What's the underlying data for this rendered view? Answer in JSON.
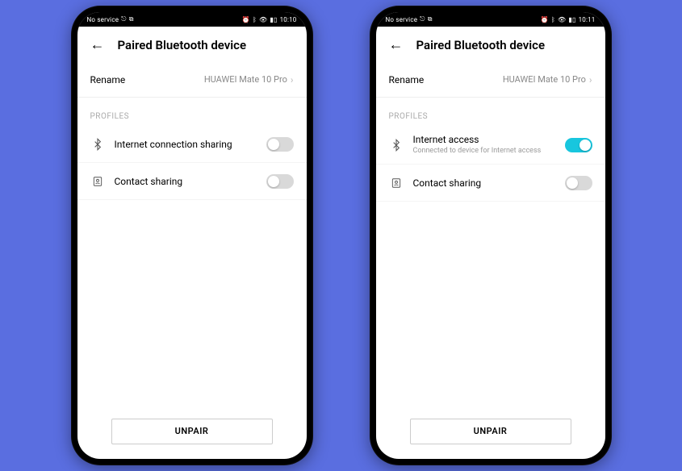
{
  "phones": [
    {
      "status": {
        "left": "No service",
        "right": {
          "time": "10:10"
        }
      },
      "header": {
        "title": "Paired Bluetooth device"
      },
      "rename": {
        "label": "Rename",
        "value": "HUAWEI Mate 10 Pro"
      },
      "section": "PROFILES",
      "profiles": [
        {
          "icon": "bluetooth-share-icon",
          "title": "Internet connection sharing",
          "subtitle": "",
          "on": false
        },
        {
          "icon": "contact-icon",
          "title": "Contact sharing",
          "subtitle": "",
          "on": false
        }
      ],
      "unpair": "UNPAIR"
    },
    {
      "status": {
        "left": "No service",
        "right": {
          "time": "10:11"
        }
      },
      "header": {
        "title": "Paired Bluetooth device"
      },
      "rename": {
        "label": "Rename",
        "value": "HUAWEI Mate 10 Pro"
      },
      "section": "PROFILES",
      "profiles": [
        {
          "icon": "bluetooth-share-icon",
          "title": "Internet access",
          "subtitle": "Connected to device for Internet access",
          "on": true
        },
        {
          "icon": "contact-icon",
          "title": "Contact sharing",
          "subtitle": "",
          "on": false
        }
      ],
      "unpair": "UNPAIR"
    }
  ]
}
